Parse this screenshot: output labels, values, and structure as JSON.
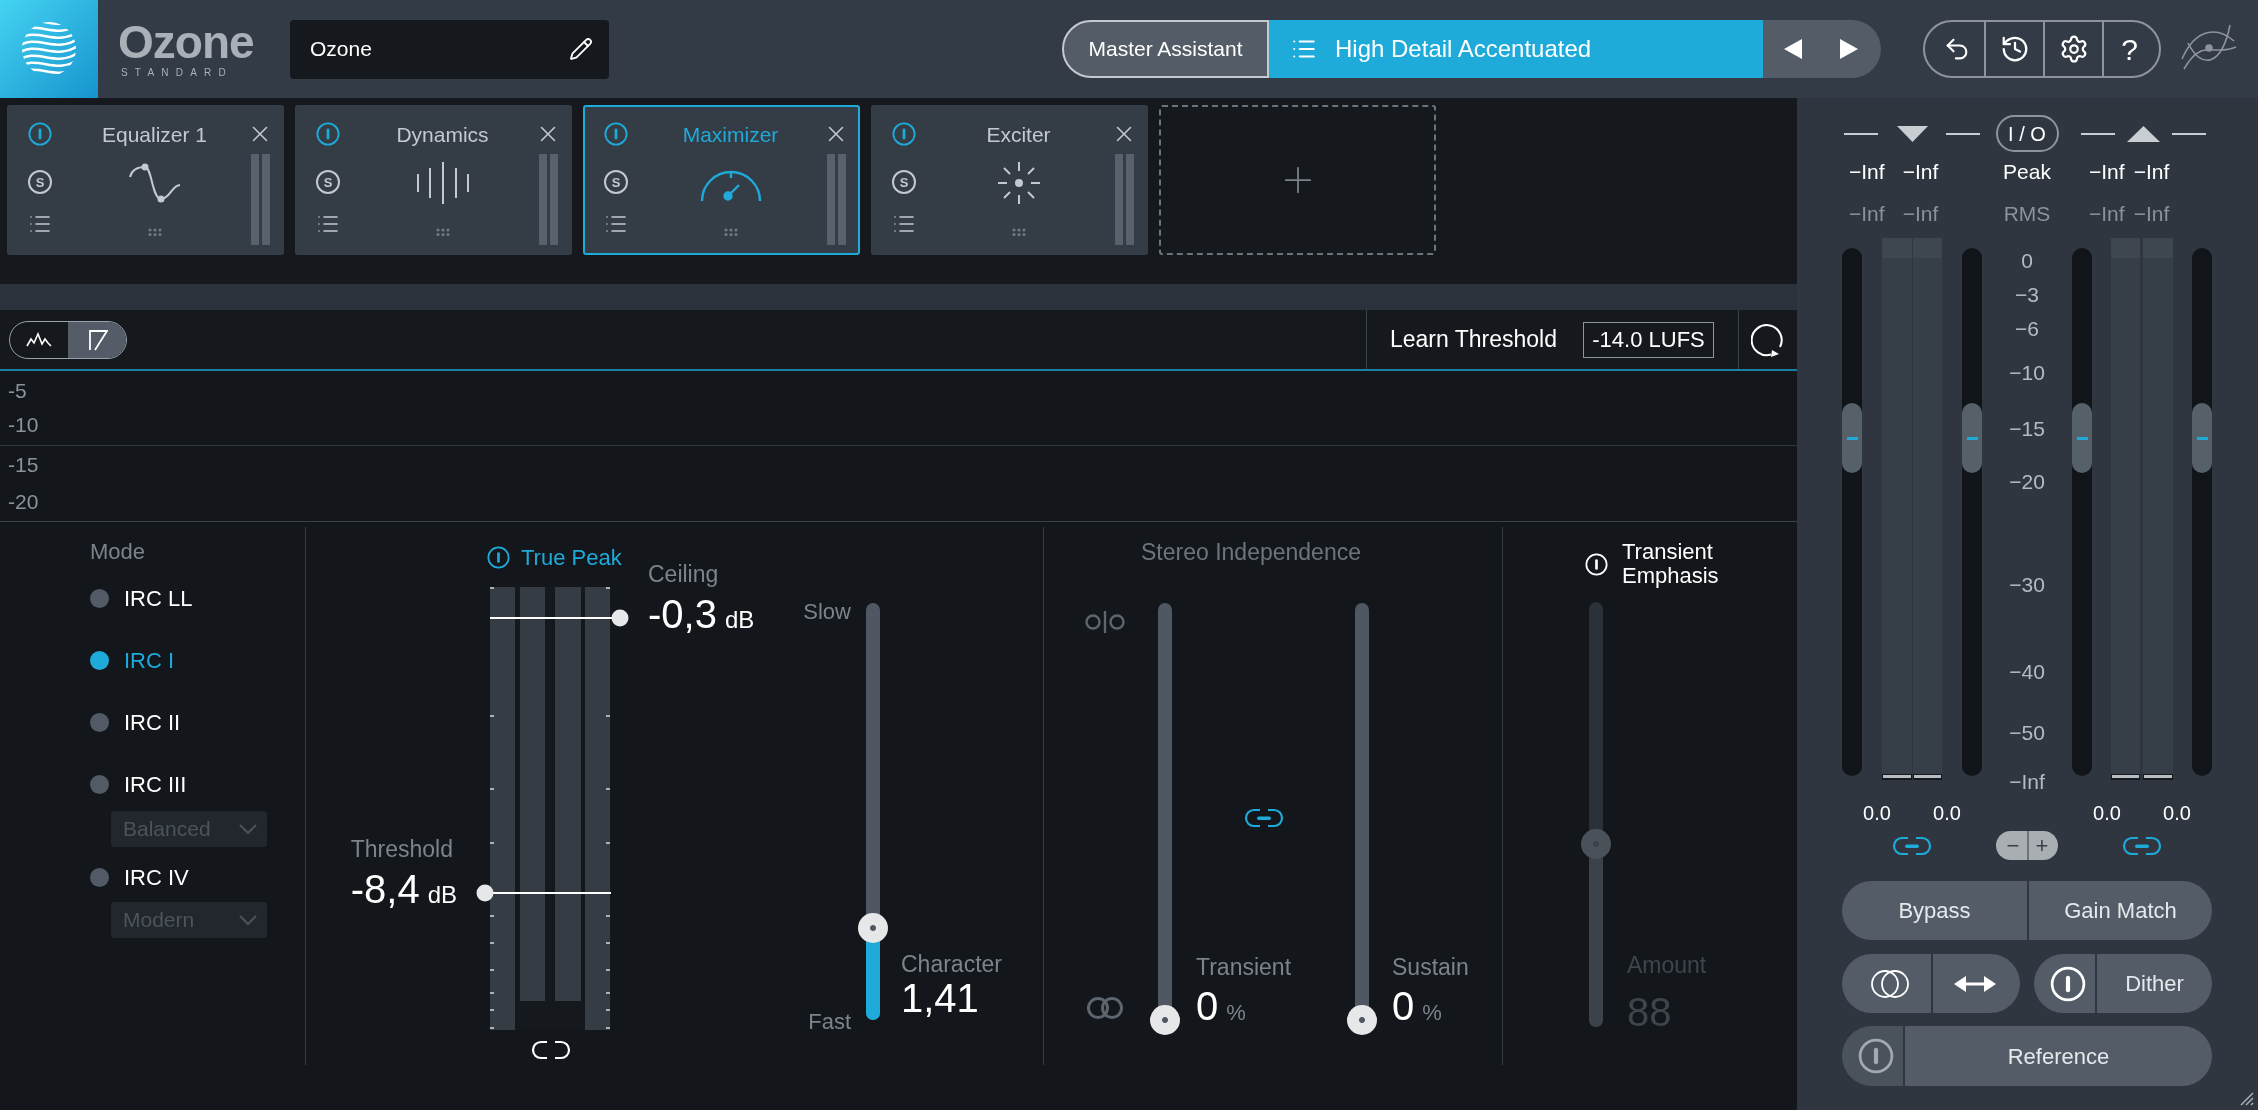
{
  "header": {
    "product_name": "Ozone",
    "edition": "STANDARD",
    "preset_name": "Ozone",
    "master_assistant": "Master Assistant",
    "preset": "High Detail Accentuated",
    "help": "?"
  },
  "modules": [
    {
      "name": "Equalizer 1",
      "kind": "eq",
      "solo": "S",
      "on": true,
      "selected": false
    },
    {
      "name": "Dynamics",
      "kind": "dynamics",
      "solo": "S",
      "on": true,
      "selected": false
    },
    {
      "name": "Maximizer",
      "kind": "maximizer",
      "solo": "S",
      "on": true,
      "selected": true
    },
    {
      "name": "Exciter",
      "kind": "exciter",
      "solo": "S",
      "on": true,
      "selected": false
    }
  ],
  "toolbar": {
    "views": [
      {
        "kind": "waveform",
        "selected": false
      },
      {
        "kind": "threshold",
        "selected": true
      }
    ],
    "learn_label": "Learn Threshold",
    "learn_value": "-14.0 LUFS"
  },
  "graph": {
    "labels": [
      "-5",
      "-10",
      "-15",
      "-20"
    ]
  },
  "mode": {
    "label": "Mode",
    "items": [
      {
        "label": "IRC LL",
        "selected": false
      },
      {
        "label": "IRC I",
        "selected": true
      },
      {
        "label": "IRC II",
        "selected": false
      },
      {
        "label": "IRC III",
        "selected": false,
        "option": {
          "value": "Balanced",
          "disabled": true
        }
      },
      {
        "label": "IRC IV",
        "selected": false,
        "option": {
          "value": "Modern",
          "disabled": true
        }
      }
    ]
  },
  "limiter": {
    "true_peak": {
      "label": "True Peak",
      "on": true
    },
    "ceiling": {
      "label": "Ceiling",
      "value": "-0,3",
      "unit": "dB",
      "level": 0.93
    },
    "threshold": {
      "label": "Threshold",
      "value": "-8,4",
      "unit": "dB",
      "level": 0.31
    },
    "linked": false,
    "character": {
      "slow": "Slow",
      "fast": "Fast",
      "label": "Character",
      "value": "1,41",
      "level": 0.22
    }
  },
  "stereo_independence": {
    "title": "Stereo Independence",
    "linked": true,
    "sliders": [
      {
        "label": "Transient",
        "value": "0",
        "unit": "%",
        "level": 0
      },
      {
        "label": "Sustain",
        "value": "0",
        "unit": "%",
        "level": 0
      }
    ]
  },
  "transient_emphasis": {
    "label": "Transient Emphasis",
    "on": false,
    "amount_label": "Amount",
    "value": "88",
    "level": 0.43
  },
  "io_meters": {
    "io_button": "I / O",
    "peak_label": "Peak",
    "rms_label": "RMS",
    "scale": [
      "0",
      "−3",
      "−6",
      "−10",
      "−15",
      "−20",
      "−30",
      "−40",
      "−50",
      "−Inf"
    ],
    "zoom_out": "−",
    "zoom_in": "+",
    "groups": [
      {
        "kind": "input",
        "peak": [
          "−Inf",
          "−Inf"
        ],
        "rms": [
          "−Inf",
          "−Inf"
        ],
        "faders": [
          {
            "level": 0.64
          },
          {
            "level": 0.64
          }
        ],
        "gains": [
          "0.0",
          "0.0"
        ],
        "linked": true
      },
      {
        "kind": "output",
        "peak": [
          "−Inf",
          "−Inf"
        ],
        "rms": [
          "−Inf",
          "−Inf"
        ],
        "faders": [
          {
            "level": 0.64
          },
          {
            "level": 0.64
          }
        ],
        "gains": [
          "0.0",
          "0.0"
        ],
        "linked": true
      }
    ]
  },
  "controls": {
    "bypass": "Bypass",
    "gain_match": "Gain Match",
    "dither": "Dither",
    "reference": "Reference"
  }
}
